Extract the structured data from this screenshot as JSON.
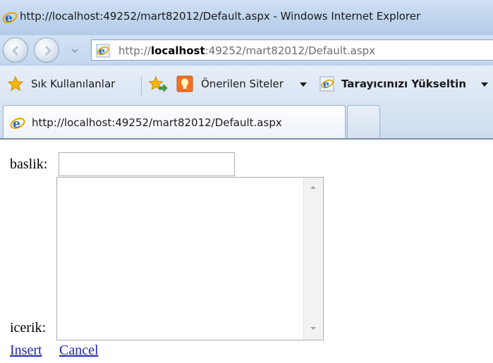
{
  "window": {
    "title": "http://localhost:49252/mart82012/Default.aspx - Windows Internet Explorer"
  },
  "address_bar": {
    "scheme": "http://",
    "host": "localhost",
    "rest": ":49252/mart82012/Default.aspx"
  },
  "favorites_bar": {
    "favorites_label": "Sık Kullanılanlar",
    "suggested_label": "Önerilen Siteler",
    "upgrade_label": "Tarayıcınızı Yükseltin"
  },
  "tabs": [
    {
      "label": "http://localhost:49252/mart82012/Default.aspx"
    }
  ],
  "form": {
    "baslik_label": "baslik:",
    "baslik_value": "",
    "icerik_label": "icerik:",
    "icerik_value": "",
    "insert_label": "Insert",
    "cancel_label": "Cancel"
  },
  "icons": {
    "browser": "ie-logo-icon",
    "back": "back-arrow-icon",
    "forward": "forward-arrow-icon",
    "favorites": "star-icon",
    "add_favorite": "add-favorite-icon",
    "suggested": "suggested-sites-icon",
    "upgrade": "ie-page-icon"
  },
  "colors": {
    "link": "#2424b8",
    "titlebar": "#bdd3ec"
  }
}
